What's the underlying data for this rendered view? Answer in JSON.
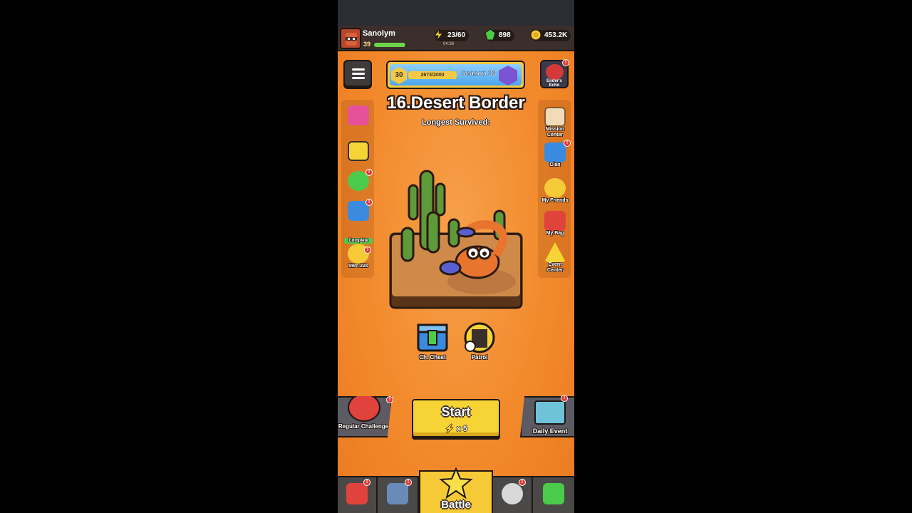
{
  "player": {
    "name": "Sanolym",
    "level": "39",
    "xp_fraction": 0.95
  },
  "resources": {
    "energy": "23/60",
    "energy_timer": "04:38",
    "gems": "898",
    "coins": "453.2K"
  },
  "season": {
    "level": "30",
    "progress_text": "2673/2000",
    "name": "Season 33"
  },
  "enders_echo": {
    "label": "Ender's Echo"
  },
  "stage": {
    "title": "16.Desert Border",
    "subtitle": "Longest Survived:"
  },
  "left_side": {
    "complete_label": "Complete",
    "timer": "59m 22s"
  },
  "right_side": {
    "items": [
      {
        "label": "Mission Center"
      },
      {
        "label": "Clan"
      },
      {
        "label": "My Friends"
      },
      {
        "label": "My Bag"
      },
      {
        "label": "Event Center"
      }
    ]
  },
  "chest": {
    "label": "Ch. Chest"
  },
  "patrol": {
    "label": "Patrol"
  },
  "buttons": {
    "regular": "Regular Challenge",
    "start": "Start",
    "start_cost": "x 5",
    "daily": "Daily Event"
  },
  "nav": {
    "battle": "Battle"
  },
  "colors": {
    "background": "#f28a2c",
    "accent": "#f6d436",
    "badge": "#e33a32"
  },
  "icons": {
    "menu": "hamburger-menu-icon",
    "energy": "lightning-icon",
    "gems": "green-gem-icon",
    "coins": "gold-coin-icon"
  }
}
